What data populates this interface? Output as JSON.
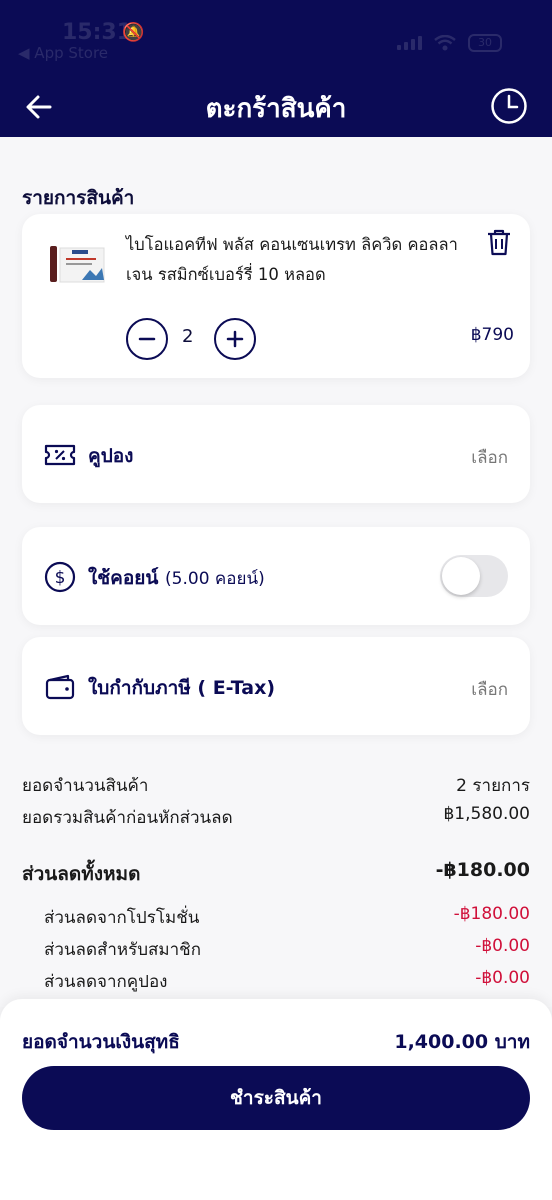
{
  "status_bar": {
    "time": "15:31",
    "back_app": "◀ App Store",
    "battery": "30"
  },
  "header": {
    "title": "ตะกร้าสินค้า",
    "back_icon": "arrow-left-icon",
    "history_icon": "clock-icon"
  },
  "cart": {
    "section_title": "รายการสินค้า",
    "items": [
      {
        "name": "ไบโอแอคทีฟ พลัส คอนเซนเทรท ลิควิด คอลลาเจน รสมิกซ์เบอร์รี่ 10 หลอด",
        "quantity": "2",
        "price": "฿790"
      }
    ]
  },
  "options": {
    "coupon": {
      "label": "คูปอง",
      "action": "เลือก",
      "icon": "coupon-icon"
    },
    "coins": {
      "label": "ใช้คอยน์",
      "sub": "(5.00 คอยน์)",
      "icon": "coin-icon",
      "enabled": false
    },
    "etax": {
      "label": "ใบกำกับภาษี ( E-Tax)",
      "action": "เลือก",
      "icon": "wallet-icon"
    }
  },
  "summary": {
    "item_count_label": "ยอดจำนวนสินค้า",
    "item_count_value": "2 รายการ",
    "subtotal_label": "ยอดรวมสินค้าก่อนหักส่วนลด",
    "subtotal_value": "฿1,580.00",
    "total_discount_label": "ส่วนลดทั้งหมด",
    "total_discount_value": "-฿180.00",
    "discounts": [
      {
        "label": "ส่วนลดจากโปรโมชั่น",
        "value": "-฿180.00"
      },
      {
        "label": "ส่วนลดสำหรับสมาชิก",
        "value": "-฿0.00"
      },
      {
        "label": "ส่วนลดจากคูปอง",
        "value": "-฿0.00"
      }
    ]
  },
  "checkout": {
    "net_label": "ยอดจำนวนเงินสุทธิ",
    "net_value": "1,400.00 บาท",
    "pay_button": "ชำระสินค้า"
  },
  "colors": {
    "primary": "#0b0b55",
    "discount_red": "#d0103a"
  }
}
